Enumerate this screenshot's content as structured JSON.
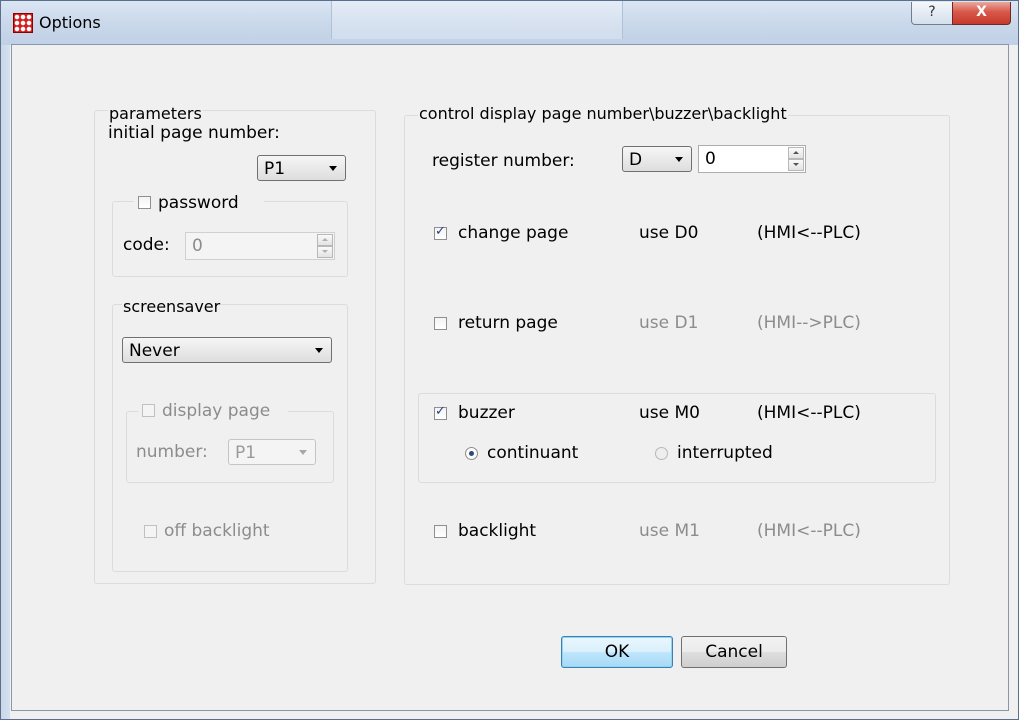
{
  "window": {
    "title": "Options",
    "help_label": "?",
    "close_label": "X"
  },
  "parameters": {
    "group_label": "parameters",
    "initial_page_label": "initial page number:",
    "initial_page_value": "P1",
    "password": {
      "label": "password",
      "checked": false,
      "code_label": "code:",
      "code_value": "0"
    },
    "screensaver": {
      "group_label": "screensaver",
      "value": "Never",
      "display_page_label": "display page",
      "number_label": "number:",
      "number_value": "P1",
      "off_backlight_label": "off backlight"
    }
  },
  "control": {
    "group_label": "control display page number\\buzzer\\backlight",
    "register_label": "register number:",
    "register_type": "D",
    "register_value": "0",
    "change_page": {
      "label": "change page",
      "checked": true,
      "use": "use D0",
      "dir": "(HMI<--PLC)"
    },
    "return_page": {
      "label": "return page",
      "checked": false,
      "use": "use D1",
      "dir": "(HMI-->PLC)"
    },
    "buzzer": {
      "label": "buzzer",
      "checked": true,
      "use": "use M0",
      "dir": "(HMI<--PLC)",
      "continuant_label": "continuant",
      "interrupted_label": "interrupted",
      "selected": "continuant"
    },
    "backlight": {
      "label": "backlight",
      "checked": false,
      "use": "use M1",
      "dir": "(HMI<--PLC)"
    }
  },
  "buttons": {
    "ok": "OK",
    "cancel": "Cancel"
  }
}
